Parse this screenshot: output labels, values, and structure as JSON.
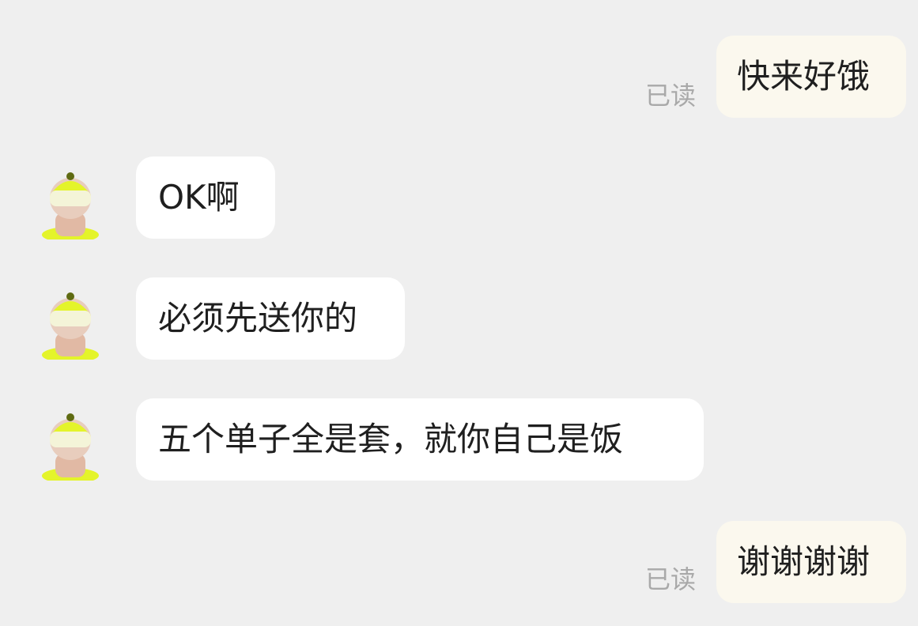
{
  "colors": {
    "background": "#efefef",
    "outgoing_bubble": "#fbf8ee",
    "incoming_bubble": "#ffffff",
    "read_receipt": "#a9a9a9",
    "avatar_accent": "#e4f42a"
  },
  "messages": [
    {
      "direction": "outgoing",
      "text": "快来好饿",
      "status": "已读"
    },
    {
      "direction": "incoming",
      "text": "OK啊",
      "avatar": "user-avatar-icon"
    },
    {
      "direction": "incoming",
      "text": "必须先送你的",
      "avatar": "user-avatar-icon"
    },
    {
      "direction": "incoming",
      "text": "五个单子全是套，就你自己是饭",
      "avatar": "user-avatar-icon"
    },
    {
      "direction": "outgoing",
      "text": "谢谢谢谢",
      "status": "已读"
    }
  ]
}
